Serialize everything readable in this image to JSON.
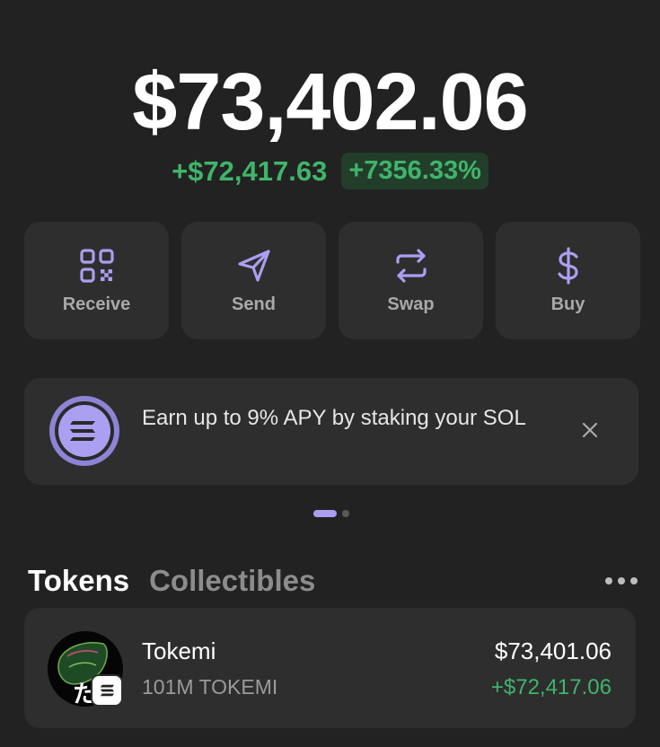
{
  "portfolio": {
    "balance": "$73,402.06",
    "change_value": "+$72,417.63",
    "change_percent": "+7356.33%"
  },
  "actions": [
    {
      "label": "Receive",
      "icon": "qr-code-icon"
    },
    {
      "label": "Send",
      "icon": "paper-plane-icon"
    },
    {
      "label": "Swap",
      "icon": "swap-arrows-icon"
    },
    {
      "label": "Buy",
      "icon": "dollar-sign-icon"
    }
  ],
  "promo": {
    "text": "Earn up to 9% APY by staking your SOL",
    "icon": "solana-logo-icon"
  },
  "carousel": {
    "pages": 2,
    "active": 1
  },
  "tabs": [
    {
      "label": "Tokens",
      "active": true
    },
    {
      "label": "Collectibles",
      "active": false
    }
  ],
  "tokens": [
    {
      "name": "Tokemi",
      "balance": "101M TOKEMI",
      "value": "$73,401.06",
      "change": "+$72,417.06"
    }
  ],
  "colors": {
    "background": "#222222",
    "card": "#2e2e2e",
    "accent": "#ab9ff2",
    "positive": "#3fb56a"
  }
}
